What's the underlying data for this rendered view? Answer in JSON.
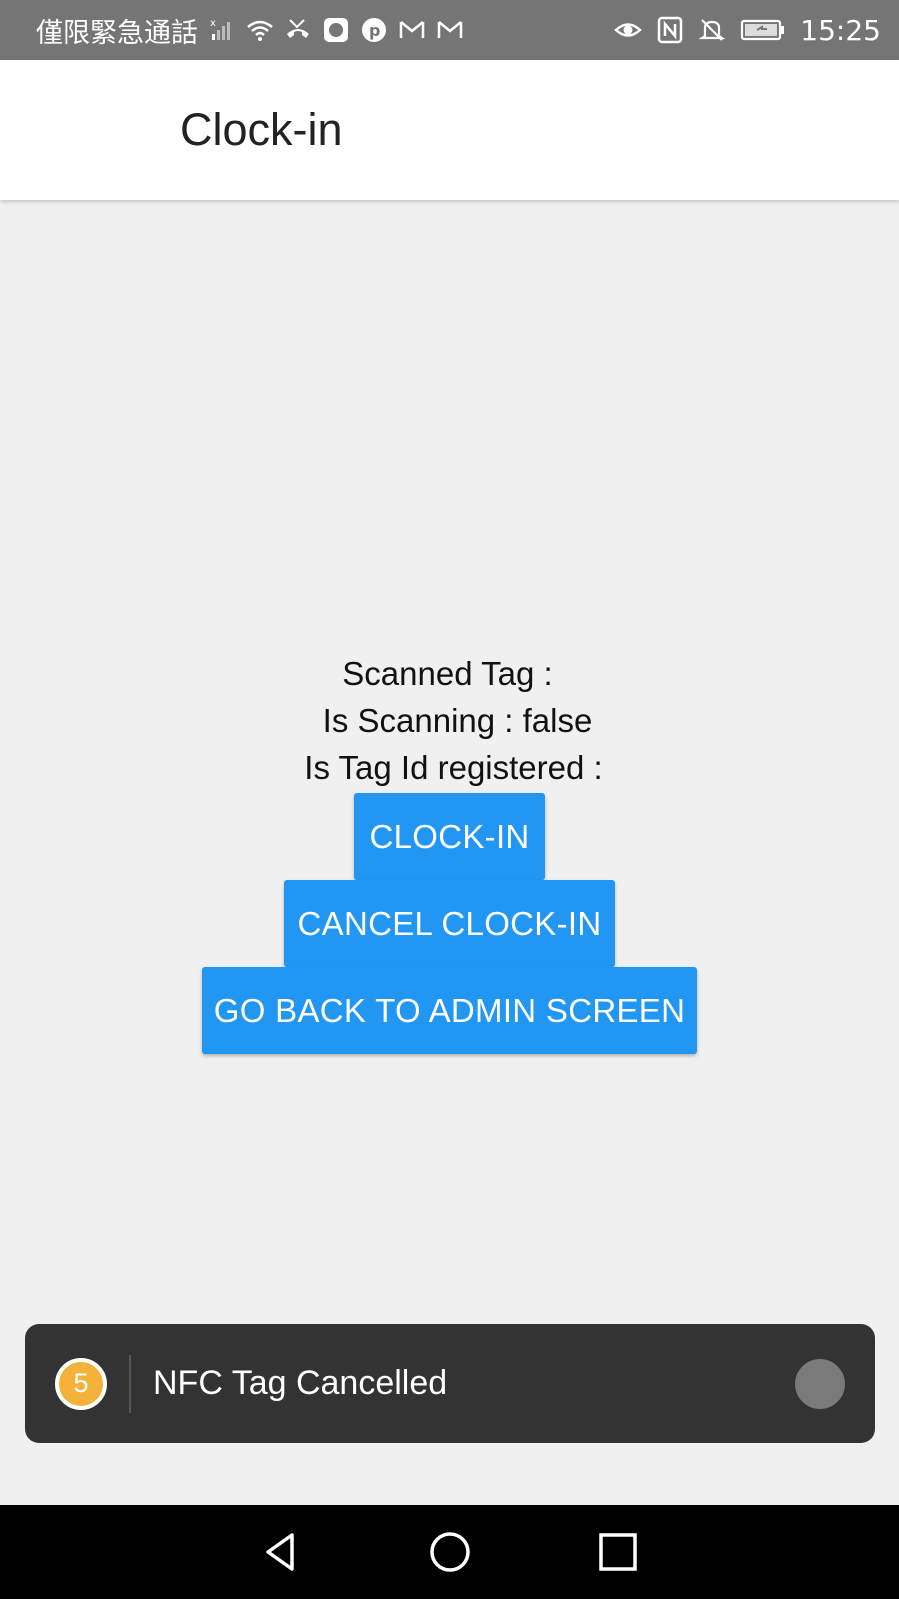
{
  "status_bar": {
    "carrier_text": "僅限緊急通話",
    "time": "15:25",
    "left_icons": [
      "signal-icon",
      "wifi-icon",
      "missed-call-icon",
      "app-icon",
      "pinterest-icon",
      "gmail-icon",
      "gmail-icon"
    ],
    "right_icons": [
      "eye-comfort-icon",
      "nfc-icon",
      "mute-icon",
      "battery-icon"
    ]
  },
  "app_bar": {
    "title": "Clock-in"
  },
  "info": {
    "scanned_tag": "Scanned Tag :",
    "is_scanning": "Is Scanning : false",
    "is_registered": "Is Tag Id registered  :"
  },
  "buttons": {
    "clock_in": "CLOCK-IN",
    "cancel_clock_in": "CANCEL CLOCK-IN",
    "go_back": "GO BACK TO ADMIN SCREEN"
  },
  "toast": {
    "badge": "5",
    "message": "NFC Tag Cancelled"
  },
  "nav_bar": {
    "icons": [
      "back-icon",
      "home-icon",
      "recents-icon"
    ]
  },
  "colors": {
    "button": "#2196f3",
    "status_bar": "#757575",
    "toast": "#333333",
    "badge": "#f4b23a"
  }
}
